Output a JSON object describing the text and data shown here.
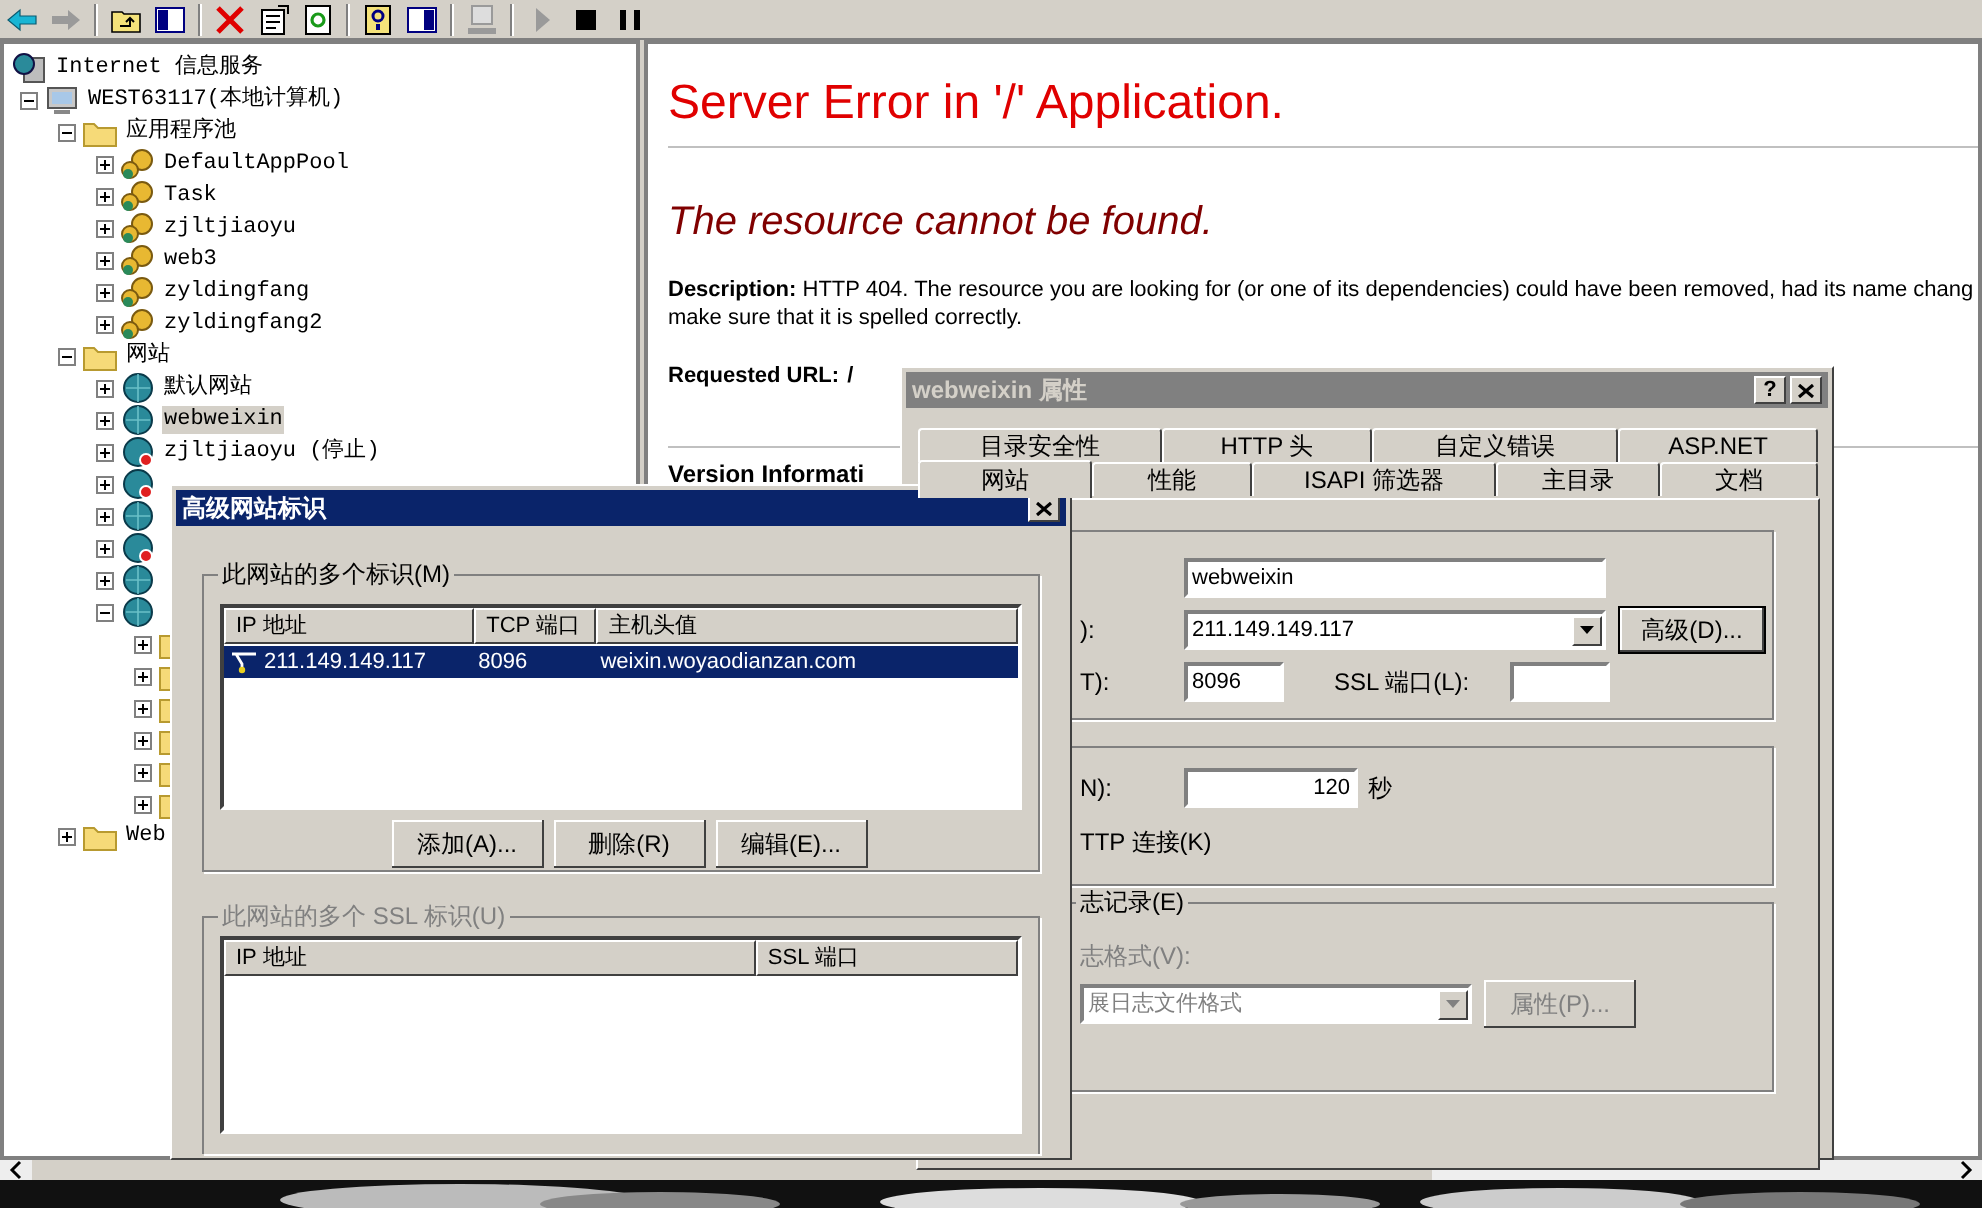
{
  "toolbar": [
    [
      {
        "kind": "back",
        "disabled": false
      },
      {
        "kind": "forward",
        "disabled": true
      }
    ],
    [
      {
        "kind": "up",
        "disabled": false
      },
      {
        "kind": "tree",
        "disabled": false
      }
    ],
    [
      {
        "kind": "delete",
        "disabled": false
      },
      {
        "kind": "properties",
        "disabled": false
      },
      {
        "kind": "refresh",
        "disabled": false
      }
    ],
    [
      {
        "kind": "help",
        "disabled": false
      },
      {
        "kind": "pane",
        "disabled": false
      }
    ],
    [
      {
        "kind": "computer",
        "disabled": true
      }
    ],
    [
      {
        "kind": "play",
        "disabled": true
      },
      {
        "kind": "stop",
        "disabled": false
      },
      {
        "kind": "pause",
        "disabled": false
      }
    ]
  ],
  "tree": [
    {
      "kind": "root",
      "label": "Internet 信息服务",
      "selected": false,
      "children": [
        {
          "kind": "computer",
          "label": "WEST63117(本地计算机)",
          "expanded": true,
          "selected": false,
          "children": [
            {
              "kind": "folder",
              "label": "应用程序池",
              "expanded": true,
              "selected": false,
              "children": [
                {
                  "kind": "pool",
                  "label": "DefaultAppPool",
                  "expanded": false,
                  "selected": false
                },
                {
                  "kind": "pool",
                  "label": "Task",
                  "expanded": false,
                  "selected": false
                },
                {
                  "kind": "pool",
                  "label": "zjltjiaoyu",
                  "expanded": false,
                  "selected": false
                },
                {
                  "kind": "pool",
                  "label": "web3",
                  "expanded": false,
                  "selected": false
                },
                {
                  "kind": "pool",
                  "label": "zyldingfang",
                  "expanded": false,
                  "selected": false
                },
                {
                  "kind": "pool",
                  "label": "zyldingfang2",
                  "expanded": false,
                  "selected": false
                }
              ]
            },
            {
              "kind": "folder",
              "label": "网站",
              "expanded": true,
              "selected": false,
              "children": [
                {
                  "kind": "site",
                  "label": "默认网站",
                  "expanded": false,
                  "selected": false
                },
                {
                  "kind": "site",
                  "label": "webweixin",
                  "expanded": false,
                  "selected": true
                },
                {
                  "kind": "site_stopped",
                  "label": "zjltjiaoyu (停止)",
                  "expanded": false,
                  "selected": false
                },
                {
                  "kind": "site_stopped",
                  "expanded": false
                },
                {
                  "kind": "site",
                  "expanded": false
                },
                {
                  "kind": "site_stopped",
                  "expanded": false
                },
                {
                  "kind": "site",
                  "expanded": false
                },
                {
                  "kind": "site",
                  "expanded": true,
                  "children": [
                    {
                      "kind": "folder",
                      "expanded": false
                    },
                    {
                      "kind": "folder",
                      "expanded": false
                    },
                    {
                      "kind": "folder",
                      "expanded": false
                    },
                    {
                      "kind": "folder",
                      "expanded": false
                    },
                    {
                      "kind": "folder",
                      "expanded": false
                    },
                    {
                      "kind": "folder",
                      "expanded": false
                    }
                  ]
                }
              ]
            },
            {
              "kind": "folder",
              "label": "Web",
              "expanded": false,
              "selected": false
            }
          ]
        }
      ]
    }
  ],
  "error_page": {
    "title": "Server Error in '/' Application.",
    "heading": "The resource cannot be found.",
    "description_lines": [
      "**Description:** HTTP 404. The resource you are looking for (or one of its dependencies) could have been removed, had its name chang",
      "make sure that it is spelled correctly."
    ],
    "requested_url_label": "Requested URL:",
    "requested_url": "/",
    "version_label": "Version Informati"
  },
  "properties_dialog": {
    "title": "webweixin 属性",
    "active": false,
    "help_button": "?",
    "tab_rows": [
      [
        {
          "label": "目录安全性",
          "selected": false
        },
        {
          "label": "HTTP 头",
          "selected": false
        },
        {
          "label": "自定义错误",
          "selected": false
        },
        {
          "label": "ASP.NET",
          "selected": false
        }
      ],
      [
        {
          "label": "网站",
          "selected": true
        },
        {
          "label": "性能",
          "selected": false
        },
        {
          "label": "ISAPI 筛选器",
          "selected": false
        },
        {
          "label": "主目录",
          "selected": false
        },
        {
          "label": "文档",
          "selected": false
        }
      ]
    ],
    "identity": {
      "description_value": "webweixin",
      "ip_label": "):",
      "ip_value": "211.149.149.117",
      "advanced_button": "高级(D)...",
      "tcp_label": "T):",
      "tcp_value": "8096",
      "ssl_label": "SSL 端口(L):"
    },
    "connections": {
      "timeout_label": "N):",
      "timeout_value": "120",
      "timeout_unit": "秒",
      "keepalive_label": "TTP 连接(K)"
    },
    "logging": {
      "legend": "志记录(E)",
      "disabled": true,
      "format_label": "志格式(V):",
      "format_value": "展日志文件格式",
      "properties_button": "属性(P)..."
    }
  },
  "advanced_dialog": {
    "title": "高级网站标识",
    "active": true,
    "identities": {
      "legend": "此网站的多个标识(M)",
      "columns": [
        "IP 地址",
        "TCP 端口",
        "主机头值"
      ],
      "rows": [
        {
          "cells": [
            "211.149.149.117",
            "8096",
            "weixin.woyaodianzan.com"
          ],
          "selected": true
        }
      ],
      "buttons": [
        "添加(A)...",
        "删除(R)",
        "编辑(E)..."
      ]
    },
    "ssl_identities": {
      "legend": "此网站的多个 SSL 标识(U)",
      "disabled": true,
      "columns": [
        "IP 地址",
        "SSL 端口"
      ]
    }
  }
}
